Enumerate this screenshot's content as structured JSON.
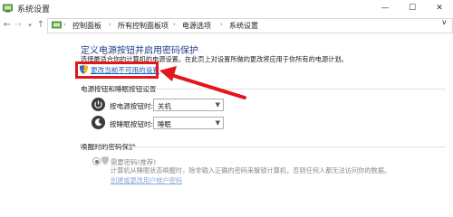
{
  "window": {
    "title": "系统设置",
    "minimize": "—",
    "maximize": "☐",
    "close": "✕"
  },
  "address": {
    "back": "←",
    "forward": "→",
    "dropdown": "▾",
    "up": "↑",
    "separator": "›",
    "breadcrumbs": [
      "控制面板",
      "所有控制面板项",
      "电源选项",
      "系统设置"
    ],
    "search_partial": "v"
  },
  "main": {
    "heading": "定义电源按钮并启用密码保护",
    "description": "选择最适合你的计算机的电源设置。在此页上对设置所做的更改将应用于你所有的电源计划。",
    "change_link": "更改当前不可用的设置",
    "power_section_title": "电源按钮和睡眠按钮设置",
    "power_button": {
      "label": "按电源按钮时:",
      "value": "关机"
    },
    "sleep_button": {
      "label": "按睡眠按钮时:",
      "value": "睡眠"
    },
    "password_section_title": "唤醒时的密码保护",
    "password_option": "需要密码(推荐)",
    "password_desc": "计算机从睡眠状态唤醒时，除非输入正确的密码来解锁计算机，否则任何人都无法访问你的数据。",
    "account_link": "创建或更改用户帐户密码"
  },
  "colors": {
    "annotation": "#e3161e",
    "link": "#1a5fb4",
    "heading": "#1f3c88"
  }
}
